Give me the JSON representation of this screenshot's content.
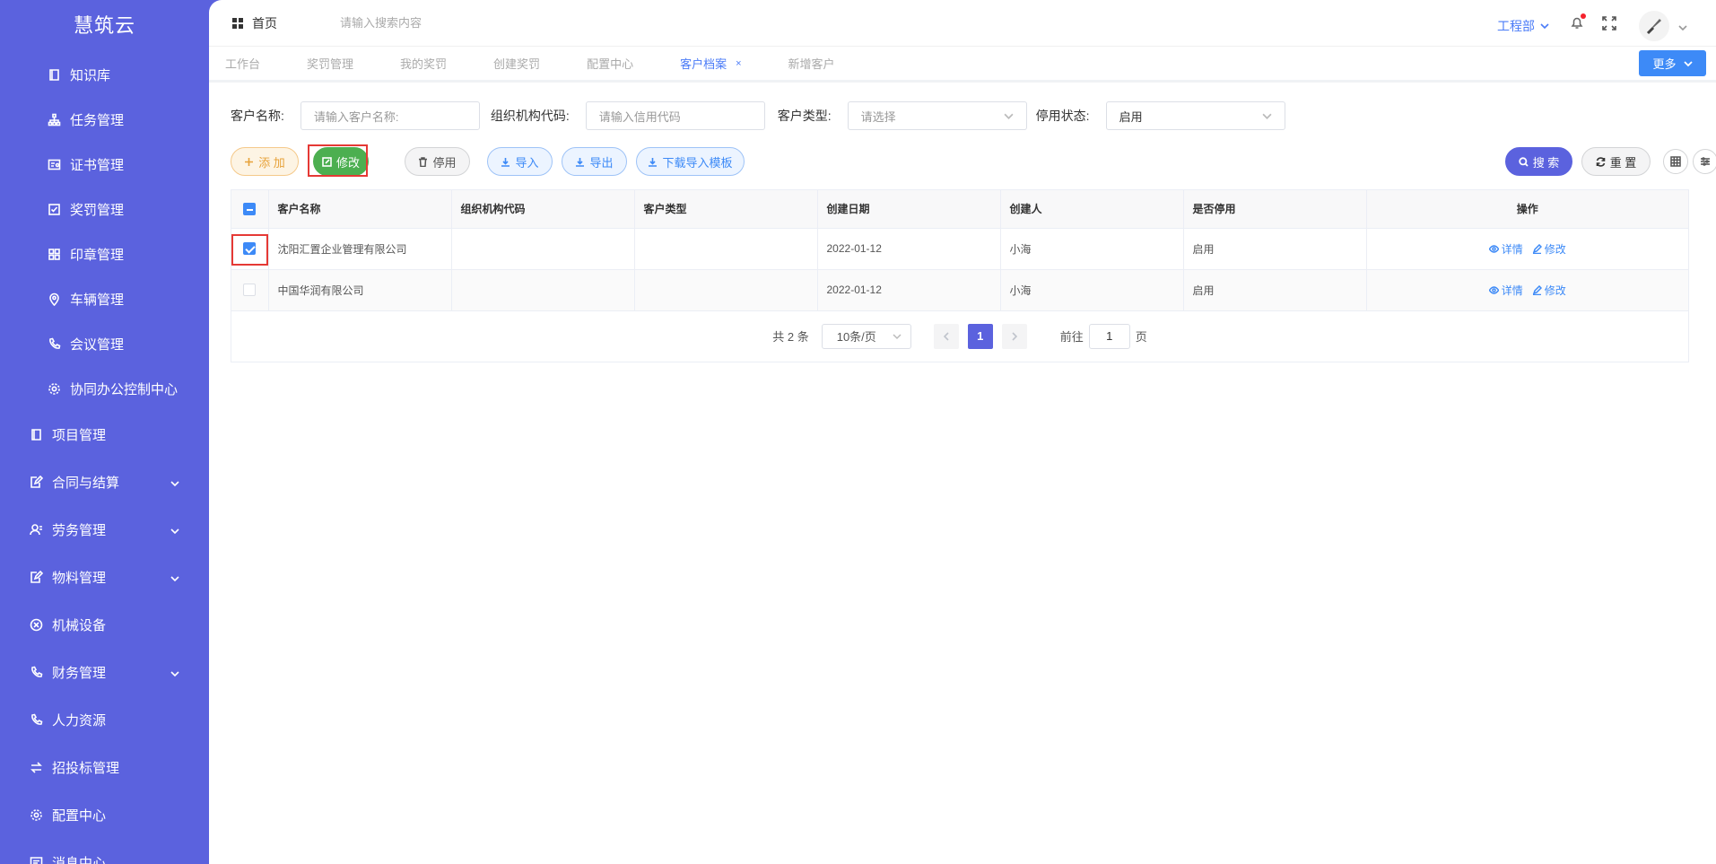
{
  "sidebar": {
    "brand": "慧筑云",
    "items": [
      {
        "label": "知识库",
        "icon": "book-icon",
        "level": "sub"
      },
      {
        "label": "任务管理",
        "icon": "sitemap-icon",
        "level": "sub"
      },
      {
        "label": "证书管理",
        "icon": "certificate-icon",
        "level": "sub"
      },
      {
        "label": "奖罚管理",
        "icon": "checkbox-icon",
        "level": "sub"
      },
      {
        "label": "印章管理",
        "icon": "grid-icon",
        "level": "sub"
      },
      {
        "label": "车辆管理",
        "icon": "location-icon",
        "level": "sub"
      },
      {
        "label": "会议管理",
        "icon": "phone-icon",
        "level": "sub"
      },
      {
        "label": "协同办公控制中心",
        "icon": "gear-icon",
        "level": "sub"
      },
      {
        "label": "项目管理",
        "icon": "book-icon",
        "level": "top"
      },
      {
        "label": "合同与结算",
        "icon": "edit-doc-icon",
        "level": "top",
        "expandable": true
      },
      {
        "label": "劳务管理",
        "icon": "user-icon",
        "level": "top",
        "expandable": true
      },
      {
        "label": "物料管理",
        "icon": "edit-doc-icon",
        "level": "top",
        "expandable": true
      },
      {
        "label": "机械设备",
        "icon": "circle-x-icon",
        "level": "top"
      },
      {
        "label": "财务管理",
        "icon": "phone-icon",
        "level": "top",
        "expandable": true
      },
      {
        "label": "人力资源",
        "icon": "phone-icon",
        "level": "top"
      },
      {
        "label": "招投标管理",
        "icon": "exchange-icon",
        "level": "top"
      },
      {
        "label": "配置中心",
        "icon": "gear-icon",
        "level": "top"
      },
      {
        "label": "消息中心",
        "icon": "message-icon",
        "level": "top"
      }
    ]
  },
  "header": {
    "home_label": "首页",
    "search_placeholder": "请输入搜索内容",
    "dept_label": "工程部"
  },
  "tabs": {
    "items": [
      {
        "label": "工作台",
        "active": false
      },
      {
        "label": "奖罚管理",
        "active": false
      },
      {
        "label": "我的奖罚",
        "active": false
      },
      {
        "label": "创建奖罚",
        "active": false
      },
      {
        "label": "配置中心",
        "active": false
      },
      {
        "label": "客户档案",
        "active": true,
        "closable": true
      },
      {
        "label": "新增客户",
        "active": false
      }
    ],
    "close_glyph": "×",
    "more_label": "更多"
  },
  "filters": {
    "name_label": "客户名称:",
    "name_placeholder": "请输入客户名称:",
    "org_label": "组织机构代码:",
    "org_placeholder": "请输入信用代码",
    "type_label": "客户类型:",
    "type_placeholder": "请选择",
    "status_label": "停用状态:",
    "status_value": "启用"
  },
  "toolbar": {
    "add_label": "添 加",
    "edit_label": "修改",
    "disable_label": "停用",
    "import_label": "导入",
    "export_label": "导出",
    "download_label": "下载导入模板",
    "search_label": "搜 索",
    "reset_label": "重 置"
  },
  "table": {
    "columns": [
      "客户名称",
      "组织机构代码",
      "客户类型",
      "创建日期",
      "创建人",
      "是否停用",
      "操作"
    ],
    "rows": [
      {
        "checked": true,
        "name": "沈阳汇置企业管理有限公司",
        "org_code": "",
        "type": "",
        "created": "2022-01-12",
        "creator": "小海",
        "status": "启用"
      },
      {
        "checked": false,
        "name": "中国华润有限公司",
        "org_code": "",
        "type": "",
        "created": "2022-01-12",
        "creator": "小海",
        "status": "启用"
      }
    ],
    "detail_label": "详情",
    "edit_label": "修改"
  },
  "pagination": {
    "total_text": "共 2 条",
    "page_size": "10条/页",
    "current_page": "1",
    "goto_prefix": "前往",
    "goto_value": "1",
    "goto_suffix": "页"
  },
  "colors": {
    "sidebar_bg": "#5b62de",
    "accent": "#3d8af7",
    "edit_green": "#4caf50",
    "highlight_red": "#e53935"
  }
}
